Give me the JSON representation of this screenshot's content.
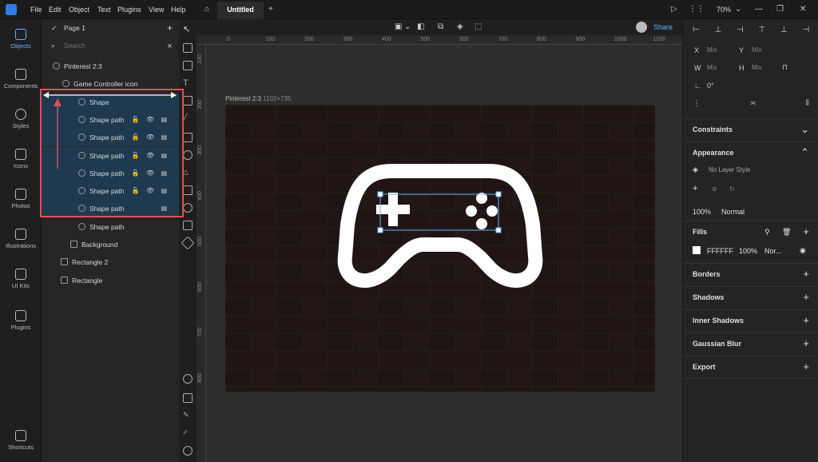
{
  "titlebar": {
    "menu": [
      "File",
      "Edit",
      "Object",
      "Text",
      "Plugins",
      "View",
      "Help"
    ],
    "tab": "Untitled",
    "zoom": "70%",
    "share": "Share"
  },
  "rail": [
    "Objects",
    "Components",
    "Styles",
    "Icons",
    "Photos",
    "Illustrations",
    "UI Kits",
    "Plugins",
    "Shortcuts"
  ],
  "layers": {
    "page": "Page 1",
    "search_placeholder": "Search",
    "rows": [
      {
        "label": "Pinterest 2:3",
        "indent": 6
      },
      {
        "label": "Game Controller icon",
        "indent": 18
      },
      {
        "label": "Shape",
        "indent": 46
      },
      {
        "label": "Shape path",
        "indent": 46
      },
      {
        "label": "Shape path",
        "indent": 46
      },
      {
        "label": "Shape path",
        "indent": 46
      },
      {
        "label": "Shape path",
        "indent": 46
      },
      {
        "label": "Shape path",
        "indent": 46
      },
      {
        "label": "Shape path",
        "indent": 46
      },
      {
        "label": "Shape path",
        "indent": 46
      },
      {
        "label": "Background",
        "indent": 36
      },
      {
        "label": "Rectangle 2",
        "indent": 24
      },
      {
        "label": "Rectangle",
        "indent": 24
      }
    ]
  },
  "ruler": {
    "top": [
      "0",
      "100",
      "200",
      "300",
      "400",
      "500",
      "600",
      "700",
      "800",
      "900",
      "1000",
      "1100"
    ],
    "left": [
      "100",
      "200",
      "300",
      "400",
      "500",
      "600",
      "700",
      "800"
    ]
  },
  "canvas": {
    "artboard_name": "Pinterest 2:3",
    "artboard_size": "1102×735",
    "shape_color": "#FFFFFF"
  },
  "inspector": {
    "x_label": "X",
    "x_val": "Mix",
    "y_label": "Y",
    "y_val": "Mix",
    "w_label": "W",
    "w_val": "Mix",
    "h_label": "H",
    "h_val": "Mix",
    "rotation": "0°",
    "constraints": "Constraints",
    "appearance": "Appearance",
    "layer_style": "No Layer Style",
    "opacity": "100%",
    "blend": "Normal",
    "fills": "Fills",
    "fill_hex": "FFFFFF",
    "fill_opacity": "100%",
    "fill_blend": "Nor...",
    "borders": "Borders",
    "shadows": "Shadows",
    "inner_shadows": "Inner Shadows",
    "gaussian": "Gaussian Blur",
    "export": "Export"
  }
}
